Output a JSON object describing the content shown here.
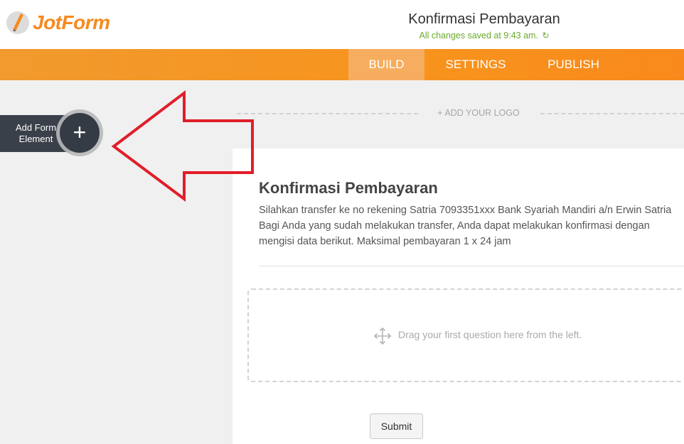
{
  "brand": {
    "name": "JotForm",
    "color": "#f68a1f",
    "icon": "jotform-pencil-icon"
  },
  "header": {
    "form_title": "Konfirmasi Pembayaran",
    "save_status": "All changes saved at 9:43 am.",
    "refresh_icon": "refresh-icon"
  },
  "nav": {
    "tabs": [
      {
        "label": "BUILD",
        "active": true
      },
      {
        "label": "SETTINGS",
        "active": false
      },
      {
        "label": "PUBLISH",
        "active": false
      }
    ]
  },
  "sidebar": {
    "add_element_label": "Add Form Element",
    "add_icon": "plus-icon"
  },
  "form": {
    "add_logo": "+ ADD YOUR LOGO",
    "title": "Konfirmasi Pembayaran",
    "description": "Silahkan transfer ke no rekening Satria 7093351xxx Bank Syariah Mandiri a/n Erwin Satria\nBagi Anda yang sudah melakukan transfer, Anda dapat melakukan konfirmasi dengan\nmengisi data berikut. Maksimal pembayaran 1 x 24 jam",
    "dropzone_text": "Drag your first question here from the left.",
    "dropzone_icon": "move-icon",
    "submit_label": "Submit"
  },
  "annotation": {
    "type": "red-arrow-pointing-left",
    "color": "#e11d2a"
  },
  "colors": {
    "nav_orange": "#f7941d",
    "active_tab": "#f7ad5f",
    "status_green": "#6aaa2a",
    "sidebar_dark": "#3a4049"
  }
}
